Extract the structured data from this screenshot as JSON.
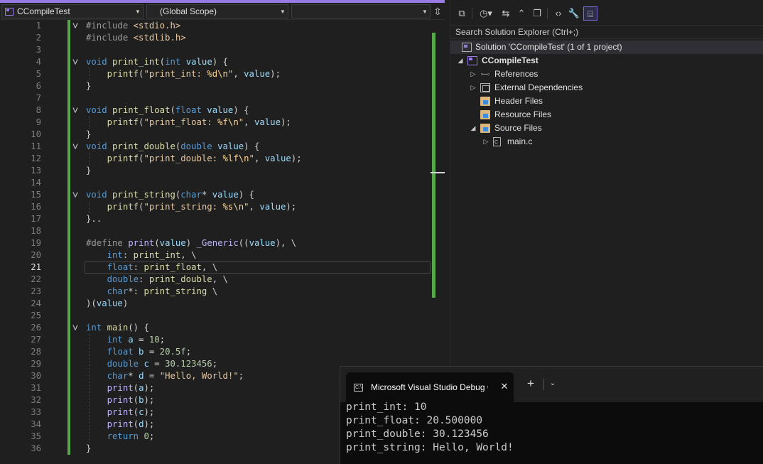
{
  "editor": {
    "project_dropdown": "CCompileTest",
    "scope_dropdown": "(Global Scope)",
    "member_dropdown": "",
    "active_line": 21,
    "lines": [
      {
        "n": 1,
        "fold": "open",
        "tokens": [
          [
            "pp",
            "#include "
          ],
          [
            "st",
            "<stdio.h>"
          ]
        ]
      },
      {
        "n": 2,
        "tokens": [
          [
            "pp",
            "#include "
          ],
          [
            "st",
            "<stdlib.h>"
          ]
        ]
      },
      {
        "n": 3,
        "tokens": []
      },
      {
        "n": 4,
        "fold": "open",
        "tokens": [
          [
            "kw",
            "void "
          ],
          [
            "fn",
            "print_int"
          ],
          [
            "df",
            "("
          ],
          [
            "kw",
            "int "
          ],
          [
            "pa",
            "value"
          ],
          [
            "df",
            ") {"
          ]
        ]
      },
      {
        "n": 5,
        "tokens": [
          [
            "df",
            "    "
          ],
          [
            "fn",
            "printf"
          ],
          [
            "df",
            "("
          ],
          [
            "st",
            "\"print_int: "
          ],
          [
            "es",
            "%d\\n"
          ],
          [
            "st",
            "\""
          ],
          [
            "df",
            ", "
          ],
          [
            "pa",
            "value"
          ],
          [
            "df",
            ");"
          ]
        ]
      },
      {
        "n": 6,
        "tokens": [
          [
            "df",
            "}"
          ]
        ]
      },
      {
        "n": 7,
        "tokens": []
      },
      {
        "n": 8,
        "fold": "open",
        "tokens": [
          [
            "kw",
            "void "
          ],
          [
            "fn",
            "print_float"
          ],
          [
            "df",
            "("
          ],
          [
            "kw",
            "float "
          ],
          [
            "pa",
            "value"
          ],
          [
            "df",
            ") {"
          ]
        ]
      },
      {
        "n": 9,
        "tokens": [
          [
            "df",
            "    "
          ],
          [
            "fn",
            "printf"
          ],
          [
            "df",
            "("
          ],
          [
            "st",
            "\"print_float: "
          ],
          [
            "es",
            "%f\\n"
          ],
          [
            "st",
            "\""
          ],
          [
            "df",
            ", "
          ],
          [
            "pa",
            "value"
          ],
          [
            "df",
            ");"
          ]
        ]
      },
      {
        "n": 10,
        "tokens": [
          [
            "df",
            "}"
          ]
        ]
      },
      {
        "n": 11,
        "fold": "open",
        "tokens": [
          [
            "kw",
            "void "
          ],
          [
            "fn",
            "print_double"
          ],
          [
            "df",
            "("
          ],
          [
            "kw",
            "double "
          ],
          [
            "pa",
            "value"
          ],
          [
            "df",
            ") {"
          ]
        ]
      },
      {
        "n": 12,
        "tokens": [
          [
            "df",
            "    "
          ],
          [
            "fn",
            "printf"
          ],
          [
            "df",
            "("
          ],
          [
            "st",
            "\"print_double: "
          ],
          [
            "es",
            "%lf\\n"
          ],
          [
            "st",
            "\""
          ],
          [
            "df",
            ", "
          ],
          [
            "pa",
            "value"
          ],
          [
            "df",
            ");"
          ]
        ]
      },
      {
        "n": 13,
        "tokens": [
          [
            "df",
            "}"
          ]
        ]
      },
      {
        "n": 14,
        "tokens": []
      },
      {
        "n": 15,
        "fold": "open",
        "tokens": [
          [
            "kw",
            "void "
          ],
          [
            "fn",
            "print_string"
          ],
          [
            "df",
            "("
          ],
          [
            "kw",
            "char"
          ],
          [
            "df",
            "* "
          ],
          [
            "pa",
            "value"
          ],
          [
            "df",
            ") {"
          ]
        ]
      },
      {
        "n": 16,
        "tokens": [
          [
            "df",
            "    "
          ],
          [
            "fn",
            "printf"
          ],
          [
            "df",
            "("
          ],
          [
            "st",
            "\"print_string: "
          ],
          [
            "es",
            "%s\\n"
          ],
          [
            "st",
            "\""
          ],
          [
            "df",
            ", "
          ],
          [
            "pa",
            "value"
          ],
          [
            "df",
            ");"
          ]
        ]
      },
      {
        "n": 17,
        "tokens": [
          [
            "df",
            "}.."
          ]
        ]
      },
      {
        "n": 18,
        "tokens": []
      },
      {
        "n": 19,
        "tokens": [
          [
            "pp",
            "#define "
          ],
          [
            "mc",
            "print"
          ],
          [
            "df",
            "("
          ],
          [
            "pa",
            "value"
          ],
          [
            "df",
            ") "
          ],
          [
            "mc",
            "_Generic"
          ],
          [
            "df",
            "(("
          ],
          [
            "pa",
            "value"
          ],
          [
            "df",
            "), \\"
          ]
        ]
      },
      {
        "n": 20,
        "tokens": [
          [
            "df",
            "    "
          ],
          [
            "kw",
            "int"
          ],
          [
            "df",
            ": "
          ],
          [
            "fn",
            "print_int"
          ],
          [
            "df",
            ", \\"
          ]
        ]
      },
      {
        "n": 21,
        "tokens": [
          [
            "df",
            "    "
          ],
          [
            "kw",
            "float"
          ],
          [
            "df",
            ": "
          ],
          [
            "fn",
            "print_float"
          ],
          [
            "df",
            ", \\"
          ]
        ]
      },
      {
        "n": 22,
        "tokens": [
          [
            "df",
            "    "
          ],
          [
            "kw",
            "double"
          ],
          [
            "df",
            ": "
          ],
          [
            "fn",
            "print_double"
          ],
          [
            "df",
            ", \\"
          ]
        ]
      },
      {
        "n": 23,
        "tokens": [
          [
            "df",
            "    "
          ],
          [
            "kw",
            "char"
          ],
          [
            "df",
            "*: "
          ],
          [
            "fn",
            "print_string"
          ],
          [
            "df",
            " \\"
          ]
        ]
      },
      {
        "n": 24,
        "tokens": [
          [
            "df",
            ")("
          ],
          [
            "pa",
            "value"
          ],
          [
            "df",
            ")"
          ]
        ]
      },
      {
        "n": 25,
        "tokens": []
      },
      {
        "n": 26,
        "fold": "open",
        "tokens": [
          [
            "kw",
            "int "
          ],
          [
            "fn",
            "main"
          ],
          [
            "df",
            "() {"
          ]
        ]
      },
      {
        "n": 27,
        "tokens": [
          [
            "df",
            "    "
          ],
          [
            "kw",
            "int "
          ],
          [
            "pa",
            "a"
          ],
          [
            "df",
            " = "
          ],
          [
            "nu",
            "10"
          ],
          [
            "df",
            ";"
          ]
        ]
      },
      {
        "n": 28,
        "tokens": [
          [
            "df",
            "    "
          ],
          [
            "kw",
            "float "
          ],
          [
            "pa",
            "b"
          ],
          [
            "df",
            " = "
          ],
          [
            "nu",
            "20.5f"
          ],
          [
            "df",
            ";"
          ]
        ]
      },
      {
        "n": 29,
        "tokens": [
          [
            "df",
            "    "
          ],
          [
            "kw",
            "double "
          ],
          [
            "pa",
            "c"
          ],
          [
            "df",
            " = "
          ],
          [
            "nu",
            "30.123456"
          ],
          [
            "df",
            ";"
          ]
        ]
      },
      {
        "n": 30,
        "tokens": [
          [
            "df",
            "    "
          ],
          [
            "kw",
            "char"
          ],
          [
            "df",
            "* "
          ],
          [
            "pa",
            "d"
          ],
          [
            "df",
            " = "
          ],
          [
            "st",
            "\"Hello, World!\""
          ],
          [
            "df",
            ";"
          ]
        ]
      },
      {
        "n": 31,
        "tokens": [
          [
            "df",
            "    "
          ],
          [
            "mc",
            "print"
          ],
          [
            "df",
            "("
          ],
          [
            "pa",
            "a"
          ],
          [
            "df",
            ");"
          ]
        ]
      },
      {
        "n": 32,
        "tokens": [
          [
            "df",
            "    "
          ],
          [
            "mc",
            "print"
          ],
          [
            "df",
            "("
          ],
          [
            "pa",
            "b"
          ],
          [
            "df",
            ");"
          ]
        ]
      },
      {
        "n": 33,
        "tokens": [
          [
            "df",
            "    "
          ],
          [
            "mc",
            "print"
          ],
          [
            "df",
            "("
          ],
          [
            "pa",
            "c"
          ],
          [
            "df",
            ");"
          ]
        ]
      },
      {
        "n": 34,
        "tokens": [
          [
            "df",
            "    "
          ],
          [
            "mc",
            "print"
          ],
          [
            "df",
            "("
          ],
          [
            "pa",
            "d"
          ],
          [
            "df",
            ");"
          ]
        ]
      },
      {
        "n": 35,
        "tokens": [
          [
            "df",
            "    "
          ],
          [
            "kw",
            "return "
          ],
          [
            "nu",
            "0"
          ],
          [
            "df",
            ";"
          ]
        ]
      },
      {
        "n": 36,
        "tokens": [
          [
            "df",
            "}"
          ]
        ]
      }
    ]
  },
  "solution_explorer": {
    "toolbar_icons": [
      "switch-views-icon",
      "history-icon",
      "sync-icon",
      "collapse-all-icon",
      "copy-icon",
      "code-icon",
      "properties-icon",
      "preview-icon"
    ],
    "search_placeholder": "Search Solution Explorer (Ctrl+;)",
    "tree": [
      {
        "label": "Solution 'CCompileTest' (1 of 1 project)",
        "icon": "solution-icon",
        "depth": 0,
        "expander": "none",
        "bold": false
      },
      {
        "label": "CCompileTest",
        "icon": "project-icon",
        "depth": 1,
        "expander": "expanded",
        "bold": true
      },
      {
        "label": "References",
        "icon": "references-icon",
        "depth": 2,
        "expander": "collapsed",
        "bold": false
      },
      {
        "label": "External Dependencies",
        "icon": "external-dependencies-icon",
        "depth": 2,
        "expander": "collapsed",
        "bold": false
      },
      {
        "label": "Header Files",
        "icon": "folder-icon",
        "depth": 2,
        "expander": "none",
        "bold": false
      },
      {
        "label": "Resource Files",
        "icon": "folder-icon",
        "depth": 2,
        "expander": "none",
        "bold": false
      },
      {
        "label": "Source Files",
        "icon": "folder-icon",
        "depth": 2,
        "expander": "expanded",
        "bold": false
      },
      {
        "label": "main.c",
        "icon": "c-file-icon",
        "depth": 3,
        "expander": "collapsed",
        "bold": false
      }
    ]
  },
  "console": {
    "tab_title": "Microsoft Visual Studio Debug Console",
    "output": [
      "print_int: 10",
      "print_float: 20.500000",
      "print_double: 30.123456",
      "print_string: Hello, World!"
    ]
  },
  "colors": {
    "accent": "#9a7be3",
    "change_bar": "#57a64a",
    "editor_bg": "#1f1f1f",
    "console_bg": "#0c0c0c"
  }
}
